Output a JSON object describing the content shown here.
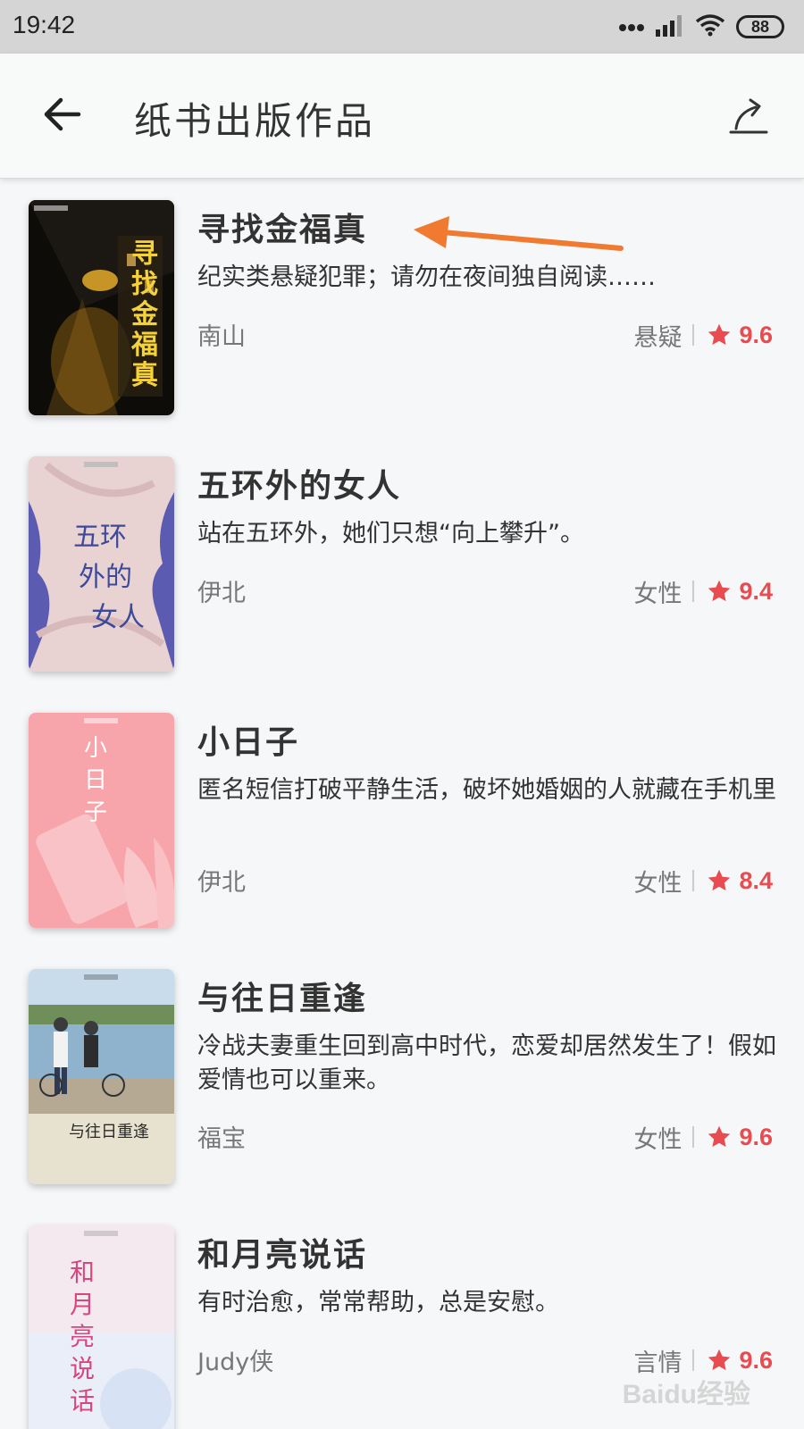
{
  "status_bar": {
    "time": "19:42",
    "battery": "88"
  },
  "header": {
    "title": "纸书出版作品"
  },
  "icons": {
    "back": "arrow-left-icon",
    "share": "share-icon",
    "star": "star-icon",
    "signal": "signal-icon",
    "wifi": "wifi-icon"
  },
  "colors": {
    "rating": "#e84b50",
    "annotation_arrow": "#f07a30"
  },
  "books": [
    {
      "title": "寻找金福真",
      "desc": "纪实类悬疑犯罪；请勿在夜间独自阅读……",
      "author": "南山",
      "category": "悬疑",
      "rating": "9.6",
      "cover_text": "寻找金福真"
    },
    {
      "title": "五环外的女人",
      "desc": "站在五环外，她们只想“向上攀升”。",
      "author": "伊北",
      "category": "女性",
      "rating": "9.4",
      "cover_text": "五环外的女人"
    },
    {
      "title": "小日子",
      "desc": "匿名短信打破平静生活，破坏她婚姻的人就藏在手机里",
      "author": "伊北",
      "category": "女性",
      "rating": "8.4",
      "cover_text": "小日子"
    },
    {
      "title": "与往日重逢",
      "desc": "冷战夫妻重生回到高中时代，恋爱却居然发生了！假如爱情也可以重来。",
      "author": "福宝",
      "category": "女性",
      "rating": "9.6",
      "cover_text": "与往日重逢"
    },
    {
      "title": "和月亮说话",
      "desc": "有时治愈，常常帮助，总是安慰。",
      "author": "Judy侠",
      "category": "言情",
      "rating": "9.6",
      "cover_text": "和月亮说话"
    }
  ],
  "watermark": "Baidu经验"
}
